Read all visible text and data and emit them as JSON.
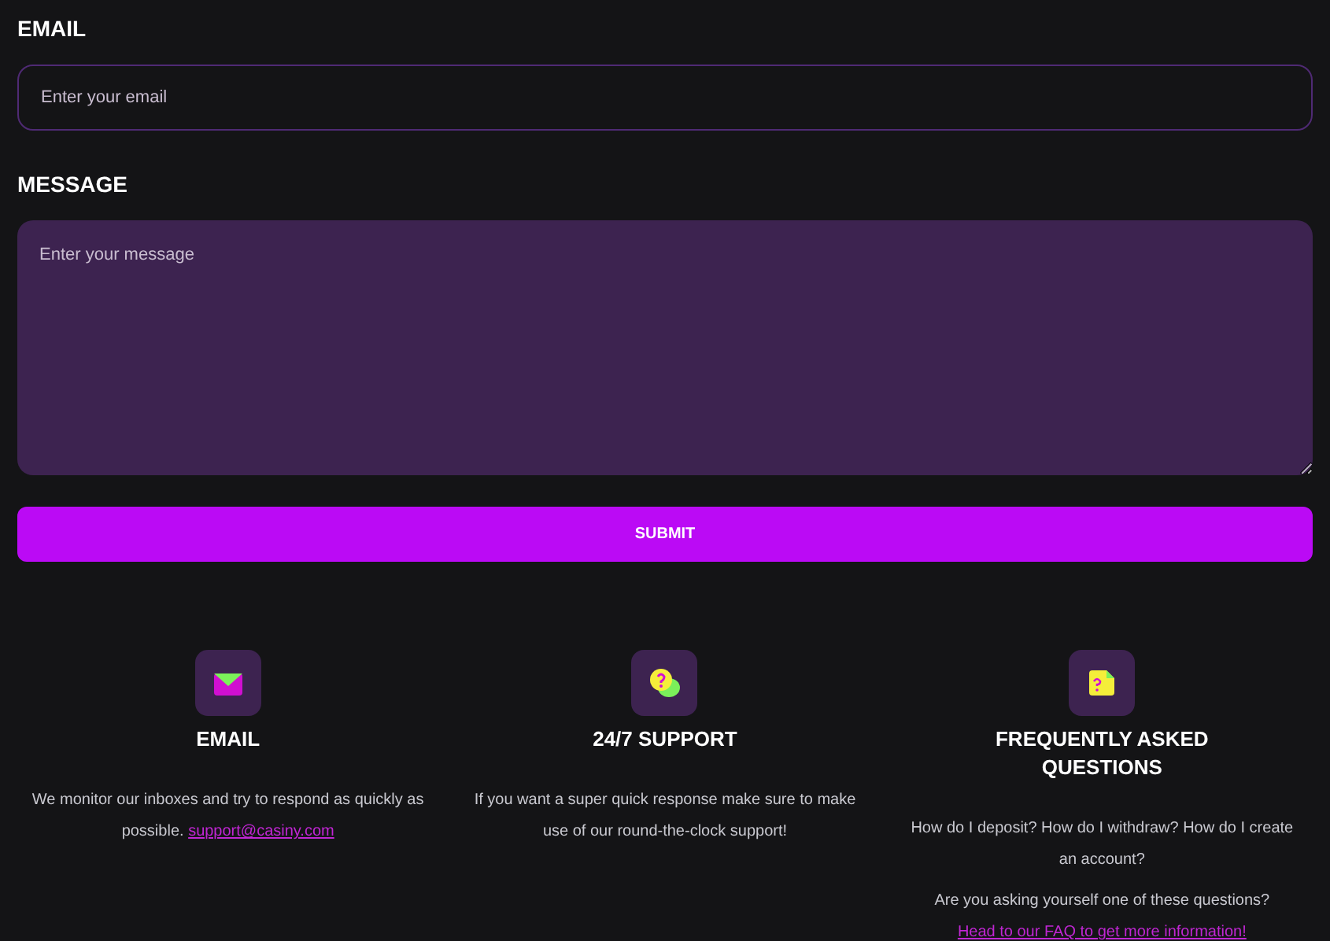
{
  "form": {
    "fields": [
      {
        "kind": "input",
        "label": "EMAIL",
        "placeholder": "Enter your email"
      },
      {
        "kind": "textarea",
        "label": "MESSAGE",
        "placeholder": "Enter your message"
      }
    ],
    "submit": "SUBMIT"
  },
  "features": [
    {
      "title": "EMAIL",
      "paragraphs": [
        {
          "text": "We monitor our inboxes and try to respond as quickly as possible.",
          "link": "support@casiny.com"
        }
      ]
    },
    {
      "title": "24/7 SUPPORT",
      "paragraphs": [
        {
          "text": "If you want a super quick response make sure to make use of our round-the-clock support!"
        }
      ]
    },
    {
      "title": "FREQUENTLY ASKED QUESTIONS",
      "paragraphs": [
        {
          "text": "How do I deposit? How do I withdraw? How do I create an account?"
        },
        {
          "text": "Are you asking yourself one of these questions?",
          "link": "Head to our FAQ to get more information!"
        }
      ]
    }
  ]
}
